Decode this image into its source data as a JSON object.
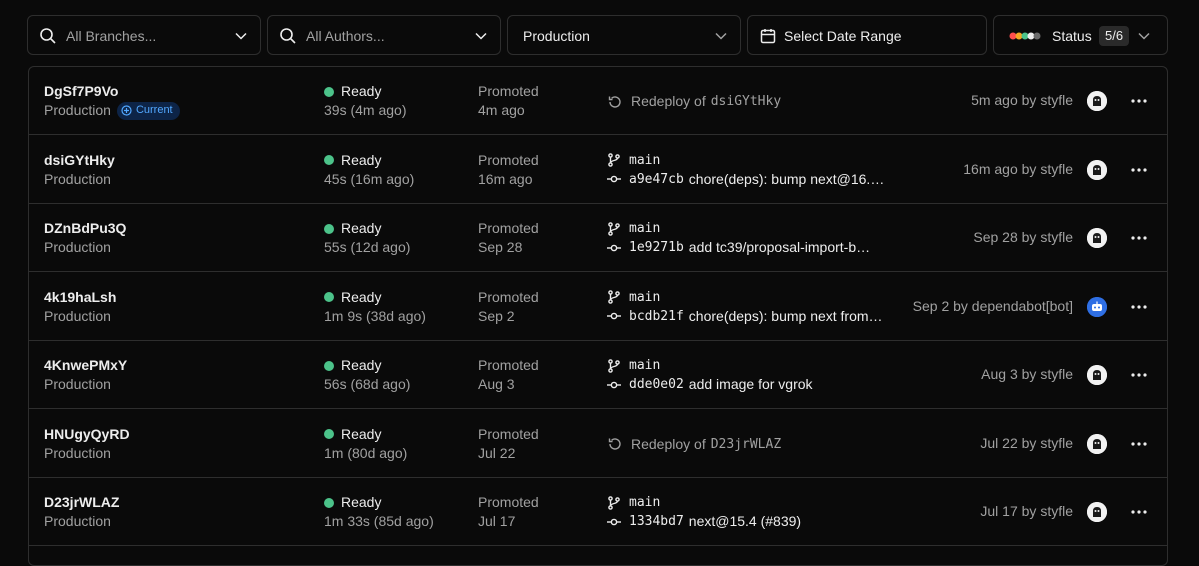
{
  "filters": {
    "branch_placeholder": "All Branches...",
    "author_placeholder": "All Authors...",
    "environment": "Production",
    "date_range": "Select Date Range",
    "status_label": "Status",
    "status_count": "5/6"
  },
  "colors": {
    "ready": "#4cc38a",
    "current_badge_bg": "#0d2447",
    "current_badge_text": "#52a8ff",
    "bot_avatar": "#2f6fe4"
  },
  "deployments": [
    {
      "id": "DgSf7P9Vo",
      "environment": "Production",
      "current_badge": "Current",
      "status": "Ready",
      "duration": "39s (4m ago)",
      "promoted": "Promoted",
      "promoted_when": "4m ago",
      "source_type": "redeploy",
      "redeploy_label": "Redeploy of",
      "redeploy_of": "dsiGYtHky",
      "when_by": "5m ago by styfle",
      "avatar": "user-avatar"
    },
    {
      "id": "dsiGYtHky",
      "environment": "Production",
      "status": "Ready",
      "duration": "45s (16m ago)",
      "promoted": "Promoted",
      "promoted_when": "16m ago",
      "source_type": "commit",
      "branch": "main",
      "sha": "a9e47cb",
      "message": "chore(deps): bump next@16.…",
      "when_by": "16m ago by styfle",
      "avatar": "user-avatar"
    },
    {
      "id": "DZnBdPu3Q",
      "environment": "Production",
      "status": "Ready",
      "duration": "55s (12d ago)",
      "promoted": "Promoted",
      "promoted_when": "Sep 28",
      "source_type": "commit",
      "branch": "main",
      "sha": "1e9271b",
      "message": "add tc39/proposal-import-b…",
      "when_by": "Sep 28 by styfle",
      "avatar": "user-avatar"
    },
    {
      "id": "4k19haLsh",
      "environment": "Production",
      "status": "Ready",
      "duration": "1m 9s (38d ago)",
      "promoted": "Promoted",
      "promoted_when": "Sep 2",
      "source_type": "commit",
      "branch": "main",
      "sha": "bcdb21f",
      "message": "chore(deps): bump next from…",
      "when_by": "Sep 2 by dependabot[bot]",
      "avatar": "bot-avatar"
    },
    {
      "id": "4KnwePMxY",
      "environment": "Production",
      "status": "Ready",
      "duration": "56s (68d ago)",
      "promoted": "Promoted",
      "promoted_when": "Aug 3",
      "source_type": "commit",
      "branch": "main",
      "sha": "dde0e02",
      "message": "add image for vgrok",
      "when_by": "Aug 3 by styfle",
      "avatar": "user-avatar"
    },
    {
      "id": "HNUgyQyRD",
      "environment": "Production",
      "status": "Ready",
      "duration": "1m (80d ago)",
      "promoted": "Promoted",
      "promoted_when": "Jul 22",
      "source_type": "redeploy",
      "redeploy_label": "Redeploy of",
      "redeploy_of": "D23jrWLAZ",
      "when_by": "Jul 22 by styfle",
      "avatar": "user-avatar"
    },
    {
      "id": "D23jrWLAZ",
      "environment": "Production",
      "status": "Ready",
      "duration": "1m 33s (85d ago)",
      "promoted": "Promoted",
      "promoted_when": "Jul 17",
      "source_type": "commit",
      "branch": "main",
      "sha": "1334bd7",
      "message": "next@15.4 (#839)",
      "when_by": "Jul 17 by styfle",
      "avatar": "user-avatar"
    }
  ]
}
